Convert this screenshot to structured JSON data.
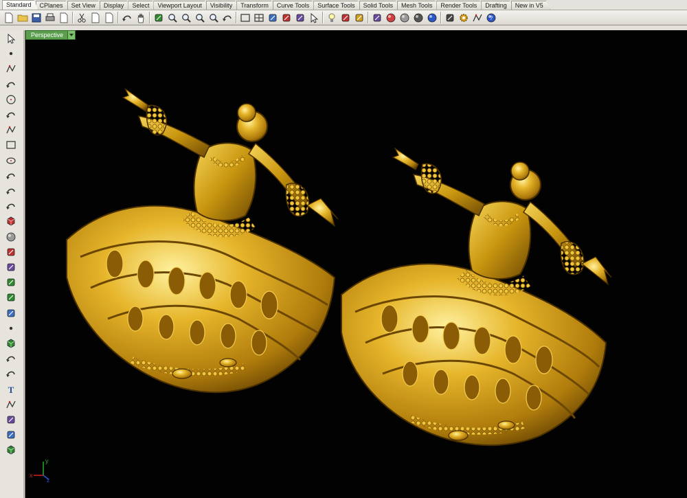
{
  "tabs": [
    {
      "label": "Standard",
      "active": true
    },
    {
      "label": "CPlanes"
    },
    {
      "label": "Set View"
    },
    {
      "label": "Display"
    },
    {
      "label": "Select"
    },
    {
      "label": "Viewport Layout"
    },
    {
      "label": "Visibility"
    },
    {
      "label": "Transform"
    },
    {
      "label": "Curve Tools"
    },
    {
      "label": "Surface Tools"
    },
    {
      "label": "Solid Tools"
    },
    {
      "label": "Mesh Tools"
    },
    {
      "label": "Render Tools"
    },
    {
      "label": "Drafting"
    },
    {
      "label": "New in V5"
    }
  ],
  "toolbar_icons": [
    "new-file-icon",
    "open-folder-icon",
    "save-icon",
    "print-icon",
    "import-icon",
    "cut-icon",
    "copy-icon",
    "paste-icon",
    "undo-icon",
    "pan-hand-icon",
    "move-view-icon",
    "zoom-window-icon",
    "zoom-extents-icon",
    "zoom-selected-icon",
    "zoom-in-icon",
    "rotate-view-icon",
    "layout-icon",
    "four-viewports-icon",
    "cplane-icon",
    "grid-snap-icon",
    "object-snap-icon",
    "select-points-icon",
    "light-bulb-icon",
    "layer-icon",
    "filter-icon",
    "properties-icon",
    "color-wheel-icon",
    "sphere-gray-icon",
    "sphere-dark-icon",
    "sphere-blue-icon",
    "render-preview-icon",
    "options-gear-icon",
    "dimension-icon",
    "help-icon"
  ],
  "sidebar_tools": [
    "select-arrow-icon",
    "point-icon",
    "polyline-icon",
    "curve-icon",
    "circle-icon",
    "arc-icon",
    "polygon-icon",
    "rectangle-icon",
    "ellipse-icon",
    "fillet-curve-icon",
    "extend-curve-icon",
    "surface-from-curves-icon",
    "box-solid-icon",
    "spheres-icon",
    "cylinder-icon",
    "plane-surface-icon",
    "boolean-union-icon",
    "move-gumball-icon",
    "drafting-icon",
    "point-edit-icon",
    "mesh-icon",
    "fillet-edges-icon",
    "rotate-icon",
    "text-icon",
    "dimension-tool-icon",
    "array-icon",
    "layer-tool-icon",
    "block-icon"
  ],
  "sidebar_more": "»",
  "viewport": {
    "title": "Perspective",
    "menu_icon": "viewport-menu-arrow-icon",
    "background": "#020202",
    "axis_labels": {
      "x": "x",
      "y": "y",
      "z": "z"
    },
    "axis_colors": {
      "x": "#d62222",
      "y": "#2ea82e",
      "z": "#2a58d8"
    },
    "models": [
      {
        "name": "dancer-figurine-left",
        "color": "#d2a018"
      },
      {
        "name": "dancer-figurine-right",
        "color": "#d2a018"
      }
    ]
  }
}
